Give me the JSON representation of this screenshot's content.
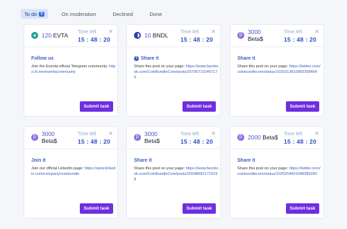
{
  "tabs": [
    {
      "label": "To do",
      "count": "6"
    },
    {
      "label": "On moderation"
    },
    {
      "label": "Declined"
    },
    {
      "label": "Done"
    }
  ],
  "cards": [
    {
      "amount": "120",
      "currency": "EVTA",
      "coin_icon": "evta-coin-icon",
      "time_label": "Time left",
      "time": "15 : 48 : 20",
      "title": "Follow us",
      "text": "Join the Eventa official Telegram community: ",
      "link": "https://t.me/eventacommunity",
      "button": "Submit task"
    },
    {
      "amount": "10",
      "currency": "BNDL",
      "coin_icon": "bndl-coin-icon",
      "time_label": "Time left",
      "time": "15 : 48 : 20",
      "title": "Share it",
      "text": "Share this post on your page: ",
      "link": "https://www.facebook.com/CoinBundleCom/posts/257967101467170",
      "button": "Submit task"
    },
    {
      "amount": "3000",
      "currency": "Beta$",
      "coin_icon": "beta-coin-icon",
      "time_label": "Time left",
      "time": "15 : 48 : 20",
      "title": "Share it",
      "text": "Share this post on your page: ",
      "link": "https://twitter.com/coinbundlecom/status/1020313810983358464",
      "button": "Submit task"
    },
    {
      "amount": "3000",
      "currency": "Beta$",
      "coin_icon": "beta-coin-icon",
      "time_label": "Time left",
      "time": "15 : 48 : 20",
      "title": "Join it",
      "text": "Join our official Linkedin page: ",
      "link": "https://www.linkedin.com/company/coinbundle",
      "button": "Submit task"
    },
    {
      "amount": "3000",
      "currency": "Beta$",
      "coin_icon": "beta-coin-icon",
      "time_label": "Time left",
      "time": "15 : 48 : 20",
      "title": "Share it",
      "text": "Share this post on your page: ",
      "link": "https://www.facebook.com/CoinBundleCom/posts/255486821715198",
      "button": "Submit task"
    },
    {
      "amount": "2000",
      "currency": "Beta$",
      "coin_icon": "beta-coin-icon",
      "time_label": "Time left",
      "time": "15 : 48 : 20",
      "title": "Share it",
      "text": "Share this post on your page: ",
      "link": "https://twitter.com/coinbundlecom/status/1020254601948385280",
      "button": "Submit task"
    }
  ],
  "colors": {
    "accent": "#6f2ee0",
    "link": "#3b5cc6",
    "tab_active_bg": "#d6e4fb"
  }
}
